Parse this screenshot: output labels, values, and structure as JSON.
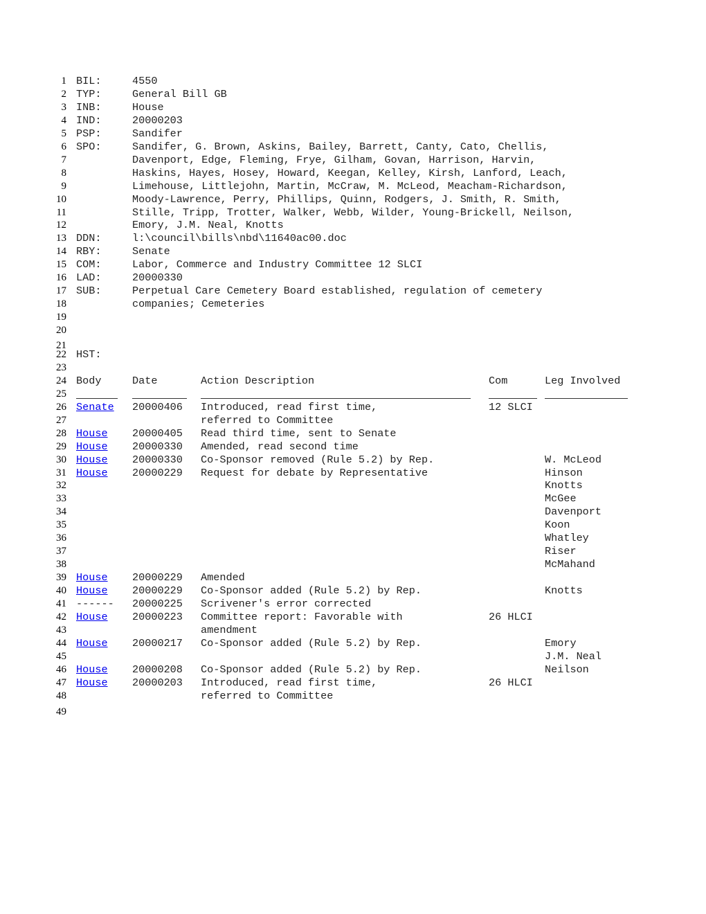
{
  "header_fields": [
    {
      "line": "1",
      "label": "BIL:",
      "value": "4550"
    },
    {
      "line": "2",
      "label": "TYP:",
      "value": "General Bill GB"
    },
    {
      "line": "3",
      "label": "INB:",
      "value": "House"
    },
    {
      "line": "4",
      "label": "IND:",
      "value": "20000203"
    },
    {
      "line": "5",
      "label": "PSP:",
      "value": "Sandifer"
    },
    {
      "line": "6",
      "label": "SPO:",
      "value": "Sandifer, G. Brown, Askins, Bailey, Barrett, Canty, Cato, Chellis,"
    },
    {
      "line": "7",
      "label": "",
      "value": "Davenport, Edge, Fleming, Frye, Gilham, Govan, Harrison, Harvin,"
    },
    {
      "line": "8",
      "label": "",
      "value": "Haskins, Hayes, Hosey, Howard, Keegan, Kelley, Kirsh, Lanford, Leach,"
    },
    {
      "line": "9",
      "label": "",
      "value": "Limehouse, Littlejohn, Martin, McCraw, M. McLeod, Meacham-Richardson,"
    },
    {
      "line": "10",
      "label": "",
      "value": "Moody-Lawrence, Perry, Phillips, Quinn, Rodgers, J. Smith, R. Smith,"
    },
    {
      "line": "11",
      "label": "",
      "value": "Stille, Tripp, Trotter, Walker, Webb, Wilder, Young-Brickell, Neilson,"
    },
    {
      "line": "12",
      "label": "",
      "value": "Emory, J.M. Neal, Knotts"
    },
    {
      "line": "13",
      "label": "DDN:",
      "value": "l:\\council\\bills\\nbd\\11640ac00.doc"
    },
    {
      "line": "14",
      "label": "RBY:",
      "value": "Senate"
    },
    {
      "line": "15",
      "label": "COM:",
      "value": "Labor, Commerce and Industry Committee 12 SLCI"
    },
    {
      "line": "16",
      "label": "LAD:",
      "value": "20000330"
    },
    {
      "line": "17",
      "label": "SUB:",
      "value": "Perpetual Care Cemetery Board established, regulation of cemetery"
    },
    {
      "line": "18",
      "label": "",
      "value": "companies; Cemeteries"
    }
  ],
  "blank_lines": [
    "19",
    "20",
    "21"
  ],
  "history": {
    "line": "22",
    "label": "HST:",
    "blank_after": "23",
    "columns_line": "24",
    "columns": {
      "body": "Body",
      "date": "Date",
      "action": "Action Description",
      "com": "Com",
      "leg": "Leg Involved"
    },
    "rule_line": "25",
    "rows": [
      {
        "line": "26",
        "body": "Senate",
        "body_link": true,
        "date": "20000406",
        "action": "Introduced, read first time,",
        "com": "12 SLCI",
        "leg": ""
      },
      {
        "line": "27",
        "body": "",
        "body_link": false,
        "date": "",
        "action": "referred to Committee",
        "com": "",
        "leg": ""
      },
      {
        "line": "28",
        "body": "House",
        "body_link": true,
        "date": "20000405",
        "action": "Read third time, sent to Senate",
        "com": "",
        "leg": ""
      },
      {
        "line": "29",
        "body": "House",
        "body_link": true,
        "date": "20000330",
        "action": "Amended, read second time",
        "com": "",
        "leg": ""
      },
      {
        "line": "30",
        "body": "House",
        "body_link": true,
        "date": "20000330",
        "action": "Co-Sponsor removed (Rule 5.2) by Rep.",
        "com": "",
        "leg": "W. McLeod"
      },
      {
        "line": "31",
        "body": "House",
        "body_link": true,
        "date": "20000229",
        "action": "Request for debate by Representative",
        "com": "",
        "leg": "Hinson"
      },
      {
        "line": "32",
        "body": "",
        "body_link": false,
        "date": "",
        "action": "",
        "com": "",
        "leg": "Knotts"
      },
      {
        "line": "33",
        "body": "",
        "body_link": false,
        "date": "",
        "action": "",
        "com": "",
        "leg": "McGee"
      },
      {
        "line": "34",
        "body": "",
        "body_link": false,
        "date": "",
        "action": "",
        "com": "",
        "leg": "Davenport"
      },
      {
        "line": "35",
        "body": "",
        "body_link": false,
        "date": "",
        "action": "",
        "com": "",
        "leg": "Koon"
      },
      {
        "line": "36",
        "body": "",
        "body_link": false,
        "date": "",
        "action": "",
        "com": "",
        "leg": "Whatley"
      },
      {
        "line": "37",
        "body": "",
        "body_link": false,
        "date": "",
        "action": "",
        "com": "",
        "leg": "Riser"
      },
      {
        "line": "38",
        "body": "",
        "body_link": false,
        "date": "",
        "action": "",
        "com": "",
        "leg": "McMahand"
      },
      {
        "line": "39",
        "body": "House",
        "body_link": true,
        "date": "20000229",
        "action": "Amended",
        "com": "",
        "leg": ""
      },
      {
        "line": "40",
        "body": "House",
        "body_link": true,
        "date": "20000229",
        "action": "Co-Sponsor added (Rule 5.2) by Rep.",
        "com": "",
        "leg": "Knotts"
      },
      {
        "line": "41",
        "body": "------",
        "body_link": false,
        "date": "20000225",
        "action": "Scrivener's error corrected",
        "com": "",
        "leg": ""
      },
      {
        "line": "42",
        "body": "House",
        "body_link": true,
        "date": "20000223",
        "action": "Committee report: Favorable with",
        "com": "26 HLCI",
        "leg": ""
      },
      {
        "line": "43",
        "body": "",
        "body_link": false,
        "date": "",
        "action": "amendment",
        "com": "",
        "leg": ""
      },
      {
        "line": "44",
        "body": "House",
        "body_link": true,
        "date": "20000217",
        "action": "Co-Sponsor added (Rule 5.2) by Rep.",
        "com": "",
        "leg": "Emory"
      },
      {
        "line": "45",
        "body": "",
        "body_link": false,
        "date": "",
        "action": "",
        "com": "",
        "leg": "J.M. Neal"
      },
      {
        "line": "46",
        "body": "House",
        "body_link": true,
        "date": "20000208",
        "action": "Co-Sponsor added (Rule 5.2) by Rep.",
        "com": "",
        "leg": "Neilson"
      },
      {
        "line": "47",
        "body": "House",
        "body_link": true,
        "date": "20000203",
        "action": "Introduced, read first time,",
        "com": "26 HLCI",
        "leg": ""
      },
      {
        "line": "48",
        "body": "",
        "body_link": false,
        "date": "",
        "action": "referred to Committee",
        "com": "",
        "leg": ""
      }
    ],
    "trailing_line": "49"
  },
  "colors": {
    "link": "#0000ee",
    "text": "#222222",
    "line_numbers": "#000000"
  }
}
